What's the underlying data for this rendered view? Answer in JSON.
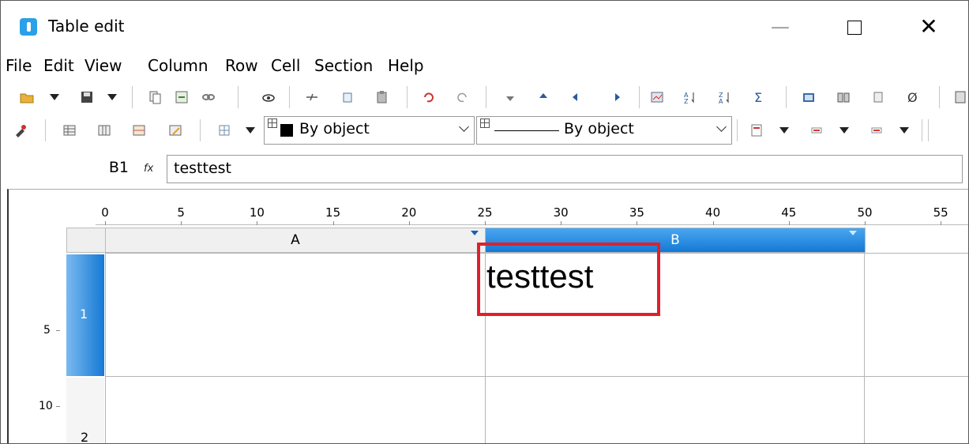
{
  "window": {
    "title": "Table edit",
    "controls": [
      "minimize",
      "maximize",
      "close"
    ]
  },
  "menu": [
    "File",
    "Edit",
    "View",
    "Column",
    "Row",
    "Cell",
    "Section",
    "Help"
  ],
  "toolbar2": {
    "border_combo": "By object",
    "line_combo": "By object"
  },
  "formula_bar": {
    "cell_ref": "B1",
    "fx_label": "fx",
    "value": "testtest"
  },
  "ruler": {
    "horizontal": [
      "0",
      "5",
      "10",
      "15",
      "20",
      "25",
      "30",
      "35",
      "40",
      "45",
      "50",
      "55"
    ],
    "vertical": [
      "5",
      "10"
    ]
  },
  "sheet": {
    "columns": [
      "A",
      "B"
    ],
    "rows": [
      "1",
      "2"
    ],
    "selected_column": "B",
    "selected_row": "1",
    "cells": {
      "B1": "testtest"
    }
  },
  "colors": {
    "selection": "#1479d4",
    "highlight_box": "#e0202c"
  }
}
